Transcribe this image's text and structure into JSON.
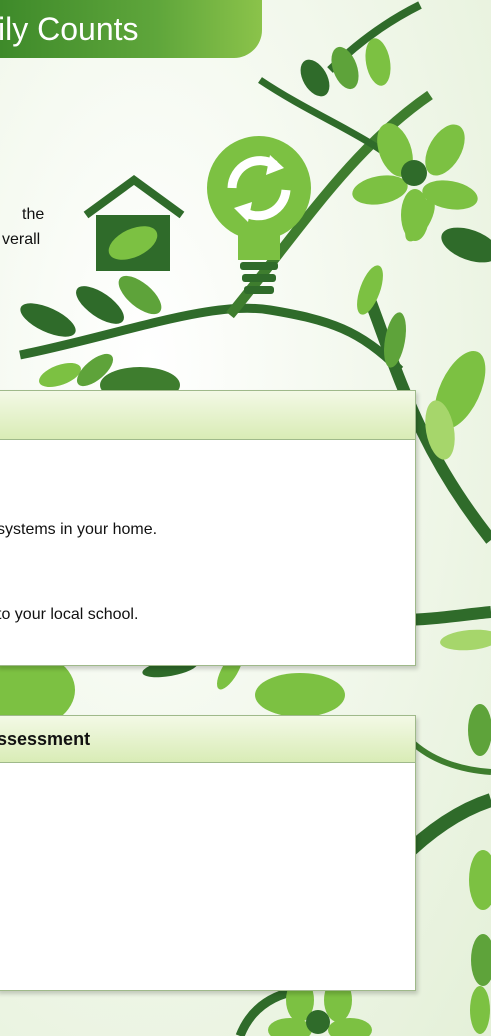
{
  "header": {
    "title": "ily Counts"
  },
  "intro": {
    "line1": "the",
    "line2": "verall"
  },
  "panel1": {
    "title": "",
    "item1": "systems in your home.",
    "item2": "to your local school."
  },
  "panel2": {
    "title": "ssessment"
  },
  "colors": {
    "title_bar": "#4e9a31",
    "panel_header": "#e2f0c8",
    "leaf_dark": "#2f6b2a",
    "leaf_light": "#7cc142"
  },
  "icons": [
    "home-leaf-icon",
    "recycle-bulb-icon",
    "flower-icon"
  ]
}
